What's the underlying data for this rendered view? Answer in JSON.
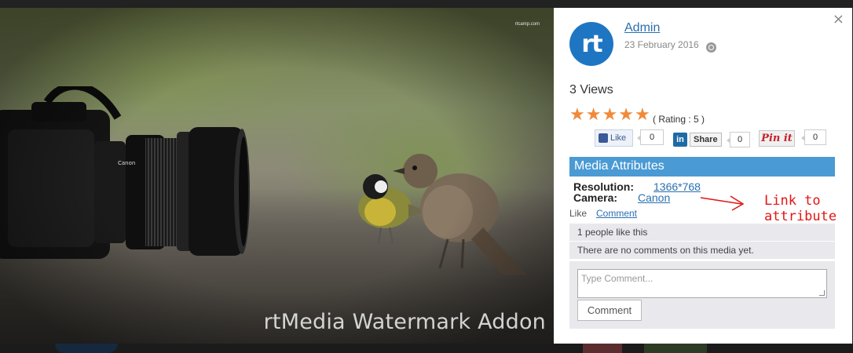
{
  "photo": {
    "credit": "rtcamp.com",
    "watermark": "rtMedia Watermark Addon"
  },
  "panel": {
    "close_label": "×",
    "avatar_letters": "rt",
    "author": "Admin",
    "date": "23 February 2016",
    "views": "3 Views",
    "rating_text": "( Rating : 5 )",
    "rating_value": 5,
    "stars": [
      "★",
      "★",
      "★",
      "★",
      "★"
    ]
  },
  "share": {
    "like_label": "Like",
    "like_count": "0",
    "linkedin_logo": "in",
    "linkedin_label": "Share",
    "linkedin_count": "0",
    "pinterest_label": "Pin it",
    "pinterest_count": "0"
  },
  "attributes": {
    "header": "Media Attributes",
    "resolution_label": "Resolution:",
    "resolution_value": "1366*768",
    "camera_label": "Camera:",
    "camera_value": "Canon"
  },
  "annotation": "Link to\nattribute\npage",
  "actions": {
    "like": "Like",
    "comment": "Comment"
  },
  "info": {
    "likes": "1 people like this",
    "no_comments": "There are no comments on this media yet."
  },
  "comment_form": {
    "placeholder": "Type Comment...",
    "submit": "Comment"
  },
  "colors": {
    "accent": "#4a9ad4",
    "avatar": "#1e76c2",
    "star": "#f08a3a",
    "link": "#2a6fb0",
    "annotation": "#e31414"
  }
}
